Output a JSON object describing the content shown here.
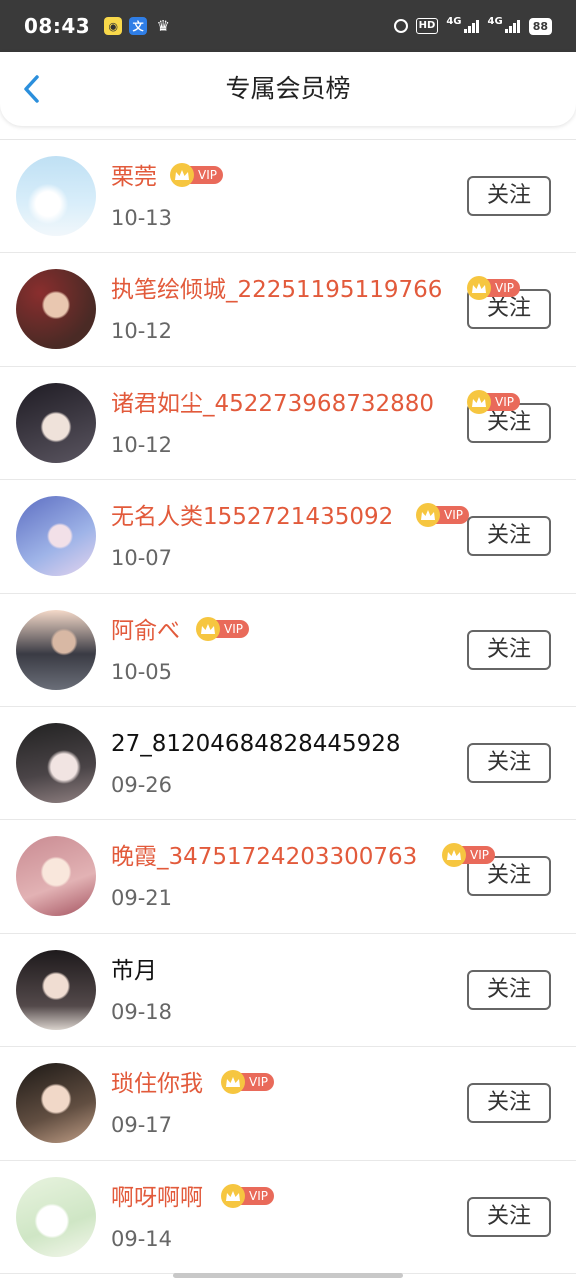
{
  "status_bar": {
    "time": "08:43",
    "app_icons": [
      {
        "icon": "chat-app-icon",
        "glyph": "◉"
      },
      {
        "icon": "alipay-icon",
        "glyph": "文"
      },
      {
        "icon": "crown-icon",
        "glyph": "♛"
      }
    ],
    "hd_label": "HD",
    "signal1_label": "4G",
    "signal2_label": "4G",
    "battery": "88"
  },
  "header": {
    "title": "专属会员榜",
    "back_icon": "chevron-left-icon"
  },
  "colors": {
    "vip_name": "#e25a3b",
    "vip_crown": "#f6c640",
    "vip_pill": "#e96a5a",
    "back_arrow": "#2b8fdc"
  },
  "follow_label": "关注",
  "vip_label": "VIP",
  "members": [
    {
      "name": "栗莞",
      "date": "10-13",
      "vip": true,
      "avatar": "sky-clouds-avatar"
    },
    {
      "name": "执笔绘倾城_22251195119766",
      "date": "10-12",
      "vip": true,
      "avatar": "anime-girl-red-avatar"
    },
    {
      "name": "诸君如尘_452273968732880",
      "date": "10-12",
      "vip": true,
      "avatar": "anime-boy-avatar"
    },
    {
      "name": "无名人类1552721435092",
      "date": "10-07",
      "vip": true,
      "avatar": "anime-girl-blue-avatar"
    },
    {
      "name": "阿俞べ",
      "date": "10-05",
      "vip": true,
      "avatar": "girl-sunset-avatar"
    },
    {
      "name": "27_81204684828445928",
      "date": "09-26",
      "vip": false,
      "avatar": "girl-portrait-avatar"
    },
    {
      "name": "晚霞_34751724203300763",
      "date": "09-21",
      "vip": true,
      "avatar": "anime-girl-pink-avatar"
    },
    {
      "name": "芇月",
      "date": "09-18",
      "vip": false,
      "avatar": "woman-traditional-avatar"
    },
    {
      "name": "琐住你我",
      "date": "09-17",
      "vip": true,
      "avatar": "man-portrait-avatar"
    },
    {
      "name": "啊呀啊啊",
      "date": "09-14",
      "vip": true,
      "avatar": "bunny-cartoon-avatar"
    }
  ]
}
